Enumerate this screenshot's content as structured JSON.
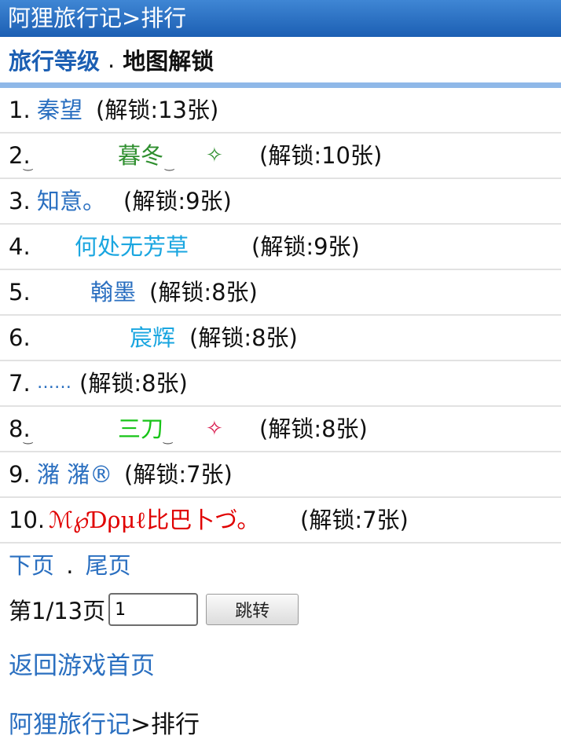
{
  "header": {
    "title": "阿狸旅行记>排行"
  },
  "tabs": {
    "level_tab": "旅行等级",
    "separator": ".",
    "map_tab": "地图解锁"
  },
  "ranking": [
    {
      "rank": "1.",
      "name": "秦望",
      "unlock": "(解锁:13张)"
    },
    {
      "rank": "2.",
      "name": "暮冬",
      "sparkle": "✧",
      "unlock": "(解锁:10张)"
    },
    {
      "rank": "3.",
      "name": "知意。",
      "unlock": "(解锁:9张)"
    },
    {
      "rank": "4.",
      "name": "何处无芳草",
      "unlock": "(解锁:9张)"
    },
    {
      "rank": "5.",
      "name": "翰墨",
      "unlock": "(解锁:8张)"
    },
    {
      "rank": "6.",
      "name": "宸辉",
      "unlock": "(解锁:8张)"
    },
    {
      "rank": "7.",
      "name": "……",
      "unlock": "(解锁:8张)"
    },
    {
      "rank": "8.",
      "name": "三刀",
      "sparkle": "✧",
      "unlock": "(解锁:8张)"
    },
    {
      "rank": "9.",
      "name": "潴 潴®",
      "unlock": "(解锁:7张)"
    },
    {
      "rank": "10.",
      "name": "ℳ℘Ɗρμℓ比巴卜づ。",
      "unlock": "(解锁:7张)"
    }
  ],
  "pager": {
    "next": "下页",
    "separator": ".",
    "last": "尾页",
    "page_label": "第1/13页",
    "page_input_value": "1",
    "jump_button": "跳转"
  },
  "footer": {
    "back_home": "返回游戏首页",
    "crumb_link": "阿狸旅行记",
    "crumb_current": ">排行"
  }
}
